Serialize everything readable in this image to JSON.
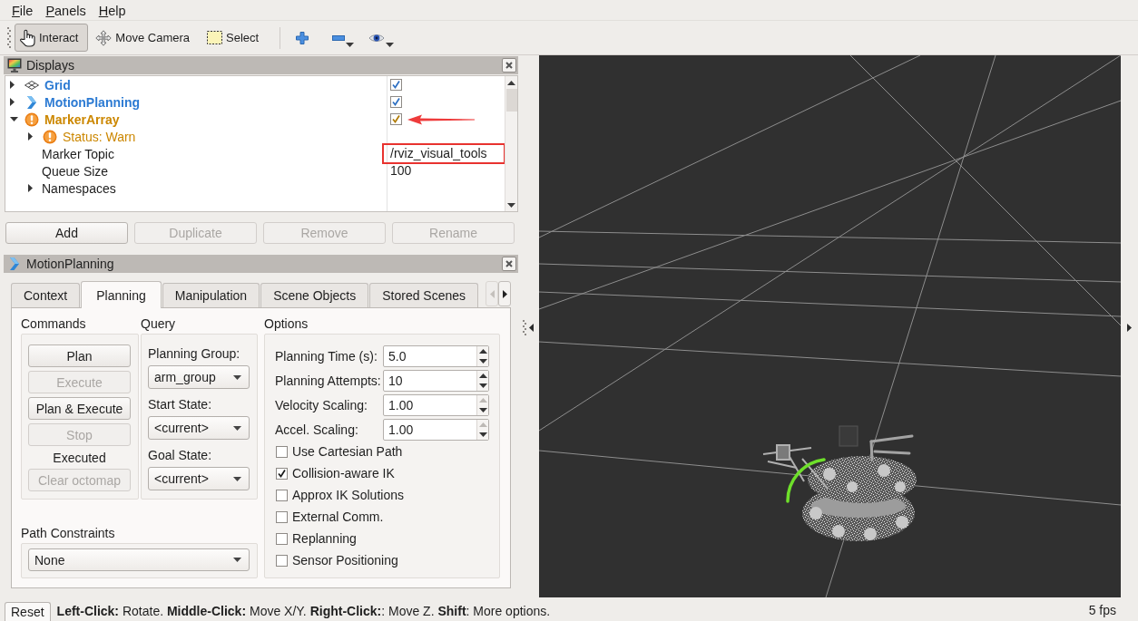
{
  "menu": [
    {
      "label": "File"
    },
    {
      "label": "Panels"
    },
    {
      "label": "Help"
    }
  ],
  "toolbar": {
    "tools": [
      {
        "kind": "interact",
        "label": "Interact",
        "selected": true
      },
      {
        "kind": "movecamera",
        "label": "Move Camera",
        "selected": false
      },
      {
        "kind": "select",
        "label": "Select",
        "selected": false
      }
    ],
    "actions": [
      {
        "kind": "add",
        "dropdown": false
      },
      {
        "kind": "remove",
        "dropdown": true
      },
      {
        "kind": "properties",
        "dropdown": true
      }
    ]
  },
  "displays": {
    "title": "Displays",
    "tree": [
      {
        "kind": "grid",
        "label": "Grid",
        "warning": false,
        "expanded": false,
        "checked": true,
        "annotated": false
      },
      {
        "kind": "motionplanning",
        "label": "MotionPlanning",
        "warning": false,
        "expanded": false,
        "checked": true,
        "annotated": false
      },
      {
        "kind": "markerarray",
        "label": "MarkerArray",
        "warning": true,
        "expanded": true,
        "checked": true,
        "annotated": true,
        "children": [
          {
            "kind": "status",
            "label": "Status: Warn",
            "warning": true,
            "expanded": false
          },
          {
            "kind": "property",
            "label": "Marker Topic",
            "value": "/rviz_visual_tools",
            "highlighted": true
          },
          {
            "kind": "property",
            "label": "Queue Size",
            "value": "100",
            "highlighted": false
          },
          {
            "kind": "group",
            "label": "Namespaces",
            "expanded": false
          }
        ]
      }
    ],
    "buttons": [
      {
        "label": "Add",
        "disabled": false
      },
      {
        "label": "Duplicate",
        "disabled": true
      },
      {
        "label": "Remove",
        "disabled": true
      },
      {
        "label": "Rename",
        "disabled": true
      }
    ]
  },
  "motion_planning": {
    "title": "MotionPlanning",
    "tabs": [
      {
        "label": "Context",
        "selected": false
      },
      {
        "label": "Planning",
        "selected": true
      },
      {
        "label": "Manipulation",
        "selected": false
      },
      {
        "label": "Scene Objects",
        "selected": false
      },
      {
        "label": "Stored Scenes",
        "selected": false
      }
    ],
    "tab_scroll": [
      {
        "kind": "left",
        "disabled": true
      },
      {
        "kind": "right",
        "disabled": false
      }
    ],
    "commands": {
      "title": "Commands",
      "items": [
        {
          "kind": "button",
          "label": "Plan",
          "disabled": false
        },
        {
          "kind": "button",
          "label": "Execute",
          "disabled": true
        },
        {
          "kind": "button",
          "label": "Plan & Execute",
          "disabled": false
        },
        {
          "kind": "button",
          "label": "Stop",
          "disabled": true
        },
        {
          "kind": "label",
          "label": "Executed"
        },
        {
          "kind": "button",
          "label": "Clear octomap",
          "disabled": true
        }
      ]
    },
    "query": {
      "title": "Query",
      "fields": [
        {
          "label": "Planning Group:",
          "value": "arm_group"
        },
        {
          "label": "Start State:",
          "value": "<current>"
        },
        {
          "label": "Goal State:",
          "value": "<current>"
        }
      ]
    },
    "options": {
      "title": "Options",
      "spinboxes": [
        {
          "label": "Planning Time (s):",
          "value": "5.0",
          "up_disabled": false
        },
        {
          "label": "Planning Attempts:",
          "value": "10",
          "up_disabled": false
        },
        {
          "label": "Velocity Scaling:",
          "value": "1.00",
          "up_disabled": true
        },
        {
          "label": "Accel. Scaling:",
          "value": "1.00",
          "up_disabled": true
        }
      ],
      "checkboxes": [
        {
          "label": "Use Cartesian Path",
          "checked": false
        },
        {
          "label": "Collision-aware IK",
          "checked": true
        },
        {
          "label": "Approx IK Solutions",
          "checked": false
        },
        {
          "label": "External Comm.",
          "checked": false
        },
        {
          "label": "Replanning",
          "checked": false
        },
        {
          "label": "Sensor Positioning",
          "checked": false
        }
      ]
    },
    "path_constraints": {
      "title": "Path Constraints",
      "value": "None"
    }
  },
  "status_bar": {
    "button": "Reset",
    "hint": "**Left-Click:** Rotate. **Middle-Click:** Move X/Y. **Right-Click:**: Move Z. **Shift**: More options.",
    "fps": "5 fps"
  }
}
